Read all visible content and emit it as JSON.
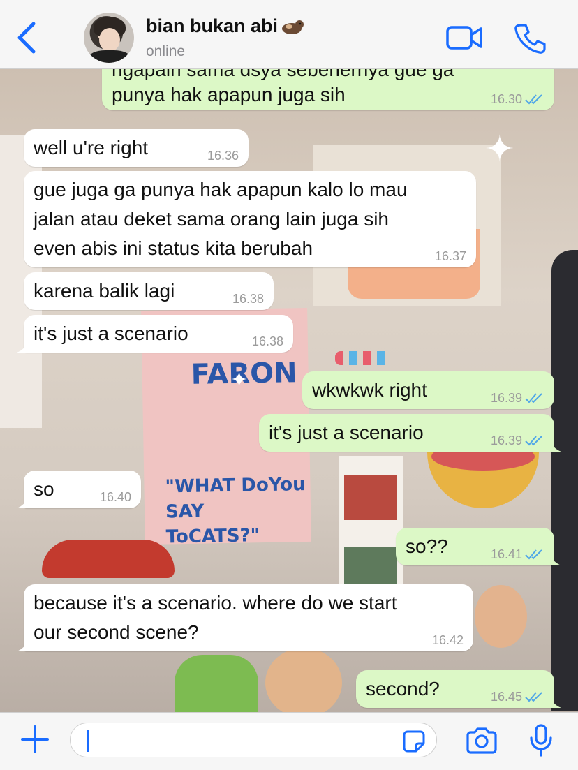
{
  "header": {
    "contact_name": "bian bukan abi",
    "status": "online"
  },
  "colors": {
    "accent": "#1a6cff",
    "incoming_bubble": "#ffffff",
    "outgoing_bubble": "#dcf8c6",
    "time_text": "#9b9b9b",
    "read_ticks": "#4fa6e8"
  },
  "background": {
    "poster_title": "FARON",
    "poster_caption_line1": "\"WHAT DoYou SAY",
    "poster_caption_line2": "ToCATS?\""
  },
  "messages": [
    {
      "direction": "out",
      "text_partial_top": "ngapain sama dsya sebenernya gue ga",
      "text": "punya hak apapun juga sih",
      "time": "16.30",
      "read": true
    },
    {
      "direction": "in",
      "text": "well u're right",
      "time": "16.36"
    },
    {
      "direction": "in",
      "lines": [
        "gue juga ga punya hak apapun kalo lo mau",
        "jalan atau deket sama orang lain juga sih",
        "even abis ini status kita berubah"
      ],
      "time": "16.37"
    },
    {
      "direction": "in",
      "text": "karena balik lagi",
      "time": "16.38"
    },
    {
      "direction": "in",
      "text": "it's just a scenario",
      "time": "16.38"
    },
    {
      "direction": "out",
      "text": "wkwkwk right",
      "time": "16.39",
      "read": true
    },
    {
      "direction": "out",
      "text": "it's just a scenario",
      "time": "16.39",
      "read": true
    },
    {
      "direction": "in",
      "text": "so",
      "time": "16.40"
    },
    {
      "direction": "out",
      "text": "so??",
      "time": "16.41",
      "read": true
    },
    {
      "direction": "in",
      "lines": [
        "because it's a scenario. where do we start",
        "our second scene?"
      ],
      "time": "16.42"
    },
    {
      "direction": "out",
      "text": "second?",
      "time": "16.45",
      "read": true
    }
  ],
  "input": {
    "value": "",
    "placeholder": ""
  },
  "icons": {
    "back": "chevron-left-icon",
    "video": "video-camera-icon",
    "call": "phone-icon",
    "plus": "plus-icon",
    "sticker": "sticker-icon",
    "camera": "camera-icon",
    "mic": "microphone-icon"
  }
}
